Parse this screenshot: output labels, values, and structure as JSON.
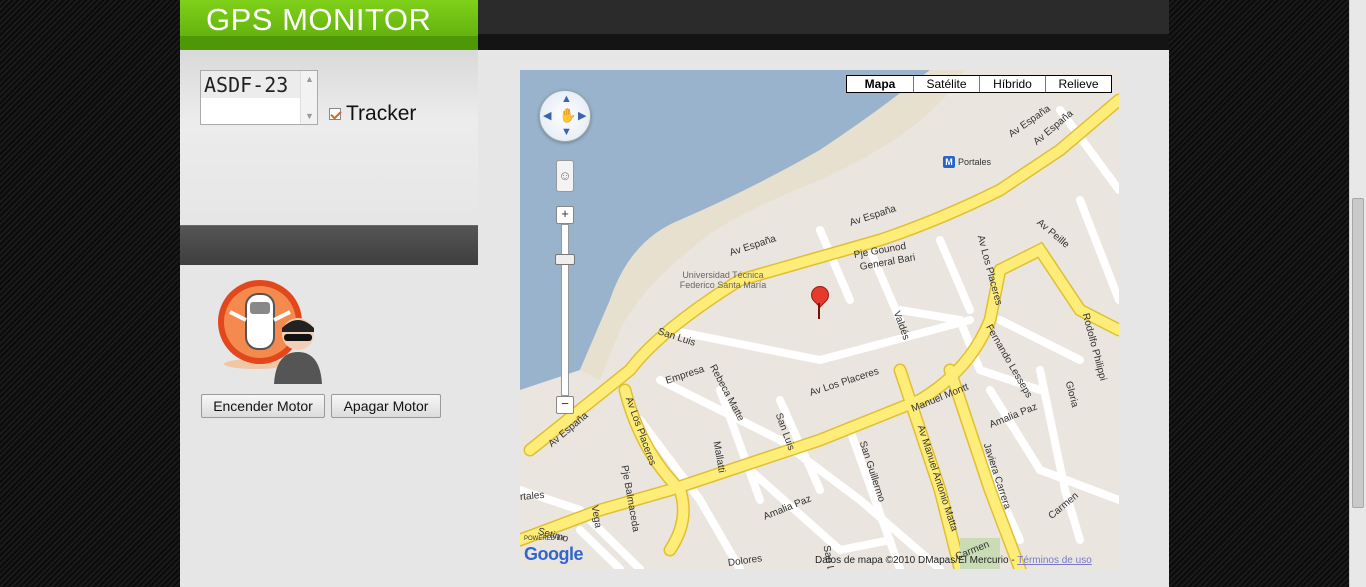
{
  "header": {
    "title": "GPS MONITOR"
  },
  "vehicle_list": {
    "items": [
      "ASDF-23"
    ]
  },
  "tracker": {
    "label": "Tracker",
    "checked": true
  },
  "buttons": {
    "start_engine": "Encender Motor",
    "stop_engine": "Apagar Motor"
  },
  "map": {
    "types": [
      "Mapa",
      "Satélite",
      "Híbrido",
      "Relieve"
    ],
    "selected_type": "Mapa",
    "streets": [
      "Av España",
      "Av España",
      "Av España",
      "Av España",
      "Av España",
      "Av Los Placeres",
      "Av Los Placeres",
      "Av Los Placeres",
      "Pje Gounod",
      "General Bari",
      "Valdés",
      "Fernando Lesseps",
      "Rodolfo Philippi",
      "Manuel Montt",
      "Amalia Paz",
      "Amalia Paz",
      "Gloria",
      "Av Manuel Antonio Matta",
      "Javiera Carrera",
      "Carmen",
      "Carmen",
      "San Luis",
      "San Luis",
      "Empresa",
      "Rebeca Matte",
      "Mallatti",
      "San Guillermo",
      "Pje Balmaceda",
      "Vega",
      "Setimo",
      "Dolores",
      "San Lu",
      "rtales",
      "Av Peille"
    ],
    "poi": "Universidad Técnica Federico Santa María",
    "metro_label": "Portales",
    "google_powered": "POWERED BY",
    "google_logo": "Google",
    "copyright": "Datos de mapa ©2010 DMapas/El Mercurio - ",
    "terms_link": "Términos de uso",
    "colors": {
      "water": "#99b3cc",
      "road_main": "#ffed7a",
      "road": "#ffffff",
      "land": "#eae6df"
    }
  }
}
